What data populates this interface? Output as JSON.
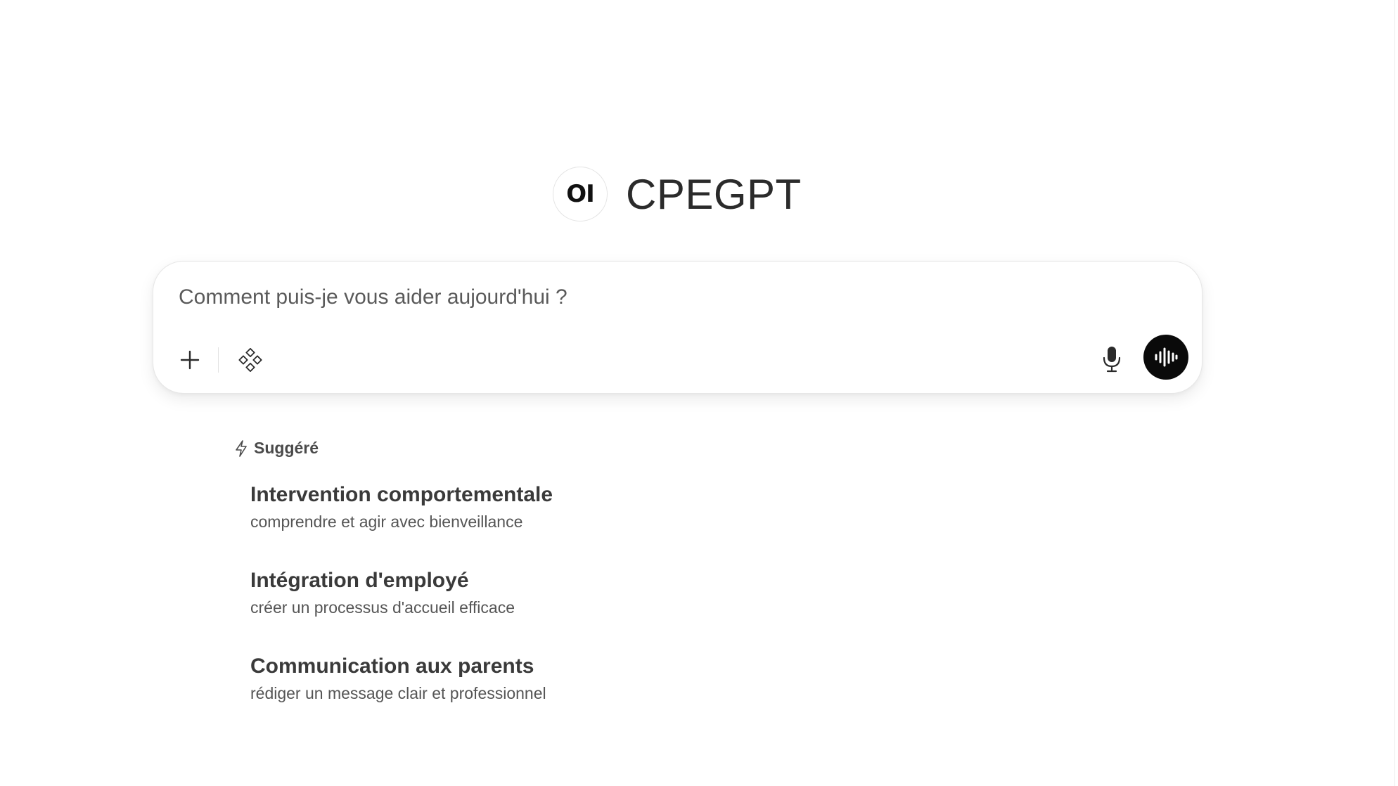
{
  "brand": {
    "logo_text": "OI",
    "title": "CPEGPT"
  },
  "composer": {
    "placeholder": "Comment puis-je vous aider aujourd'hui ?",
    "icons": {
      "add": "plus-icon",
      "tools": "integrations-icon",
      "mic": "microphone-icon",
      "voice": "voice-waveform-icon"
    }
  },
  "suggestions": {
    "header": "Suggéré",
    "header_icon": "bolt-icon",
    "items": [
      {
        "title": "Intervention comportementale",
        "subtitle": "comprendre et agir avec bienveillance"
      },
      {
        "title": "Intégration d'employé",
        "subtitle": "créer un processus d'accueil efficace"
      },
      {
        "title": "Communication aux parents",
        "subtitle": "rédiger un message clair et professionnel"
      }
    ]
  },
  "colors": {
    "background": "#ffffff",
    "voice_button": "#0a0a0a",
    "text_primary": "#3a3a3a",
    "text_secondary": "#555555"
  }
}
